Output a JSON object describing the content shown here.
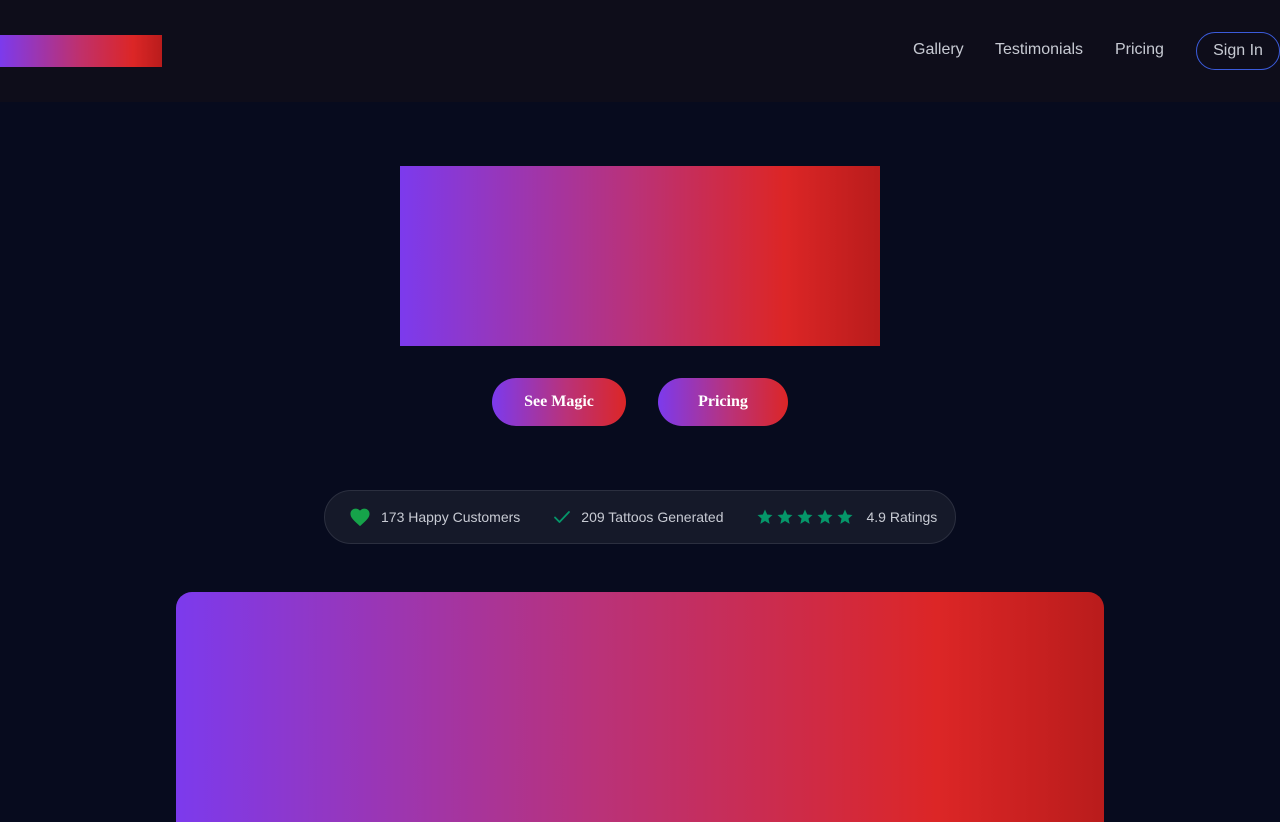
{
  "nav": {
    "links": [
      "Gallery",
      "Testimonials",
      "Pricing"
    ],
    "signin_label": "Sign In"
  },
  "hero": {
    "buttons": [
      "See Magic",
      "Pricing"
    ]
  },
  "stats": {
    "customers": "173 Happy Customers",
    "tattoos": "209 Tattoos Generated",
    "ratings": "4.9 Ratings",
    "star_rating": 5,
    "icons": [
      "heart-icon",
      "check-icon",
      "star-icon"
    ]
  },
  "colors": {
    "background": "#070b1e",
    "header": "#0e0d1a",
    "gradient_start": "#7c3aed",
    "gradient_mid": "#dc2626",
    "gradient_end": "#b91c1c",
    "accent_green": "#059669",
    "signin_border": "#3b5bdb"
  }
}
